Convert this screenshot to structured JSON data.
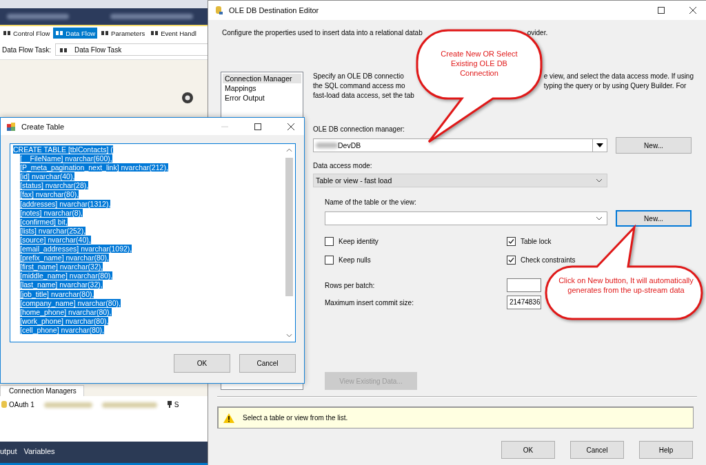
{
  "ide": {
    "designer_tabs": [
      {
        "label": "Control Flow",
        "selected": false
      },
      {
        "label": "Data Flow",
        "selected": true
      },
      {
        "label": "Parameters",
        "selected": false
      },
      {
        "label": "Event Handl",
        "selected": false
      }
    ],
    "task_label": "Data Flow Task:",
    "task_value": "Data Flow Task",
    "connection_managers": {
      "tab": "Connection Managers",
      "items": [
        "OAuth 1",
        "S"
      ]
    },
    "bottom_tabs": [
      "utput",
      "Variables"
    ]
  },
  "editor": {
    "title": "OLE DB Destination Editor",
    "description": [
      "Configure the properties used to insert data into a relational datab",
      "ovider."
    ],
    "pages": [
      {
        "label": "Connection Manager",
        "selected": true
      },
      {
        "label": "Mappings",
        "selected": false
      },
      {
        "label": "Error Output",
        "selected": false
      }
    ],
    "intro_left": [
      "Specify an OLE DB connectio",
      "the SQL command access mo",
      "fast-load data access, set the tab"
    ],
    "intro_right": [
      "e view, and select the data access mode. If using",
      "typing the query or by using Query Builder. For"
    ],
    "connection": {
      "label": "OLE DB connection manager:",
      "value": "DevDB",
      "button": {
        "label": "New...",
        "focused": false
      }
    },
    "access_mode": {
      "label": "Data access mode:",
      "value": "Table or view - fast load"
    },
    "table": {
      "label": "Name of the table or the view:",
      "button": {
        "label": "New...",
        "focused": true
      }
    },
    "options": [
      {
        "label": "Keep identity",
        "checked": false
      },
      {
        "label": "Table lock",
        "checked": true
      },
      {
        "label": "Keep nulls",
        "checked": false
      },
      {
        "label": "Check constraints",
        "checked": true
      }
    ],
    "rows_per_batch": {
      "label": "Rows per batch:"
    },
    "max_commit": {
      "label": "Maximum insert commit size:",
      "value": "21474836"
    },
    "view_button": {
      "label": "View Existing Data...",
      "disabled": true
    },
    "warning": "Select a table or view from the list.",
    "buttons": [
      "OK",
      "Cancel",
      "Help"
    ]
  },
  "create_table": {
    "title": "Create Table",
    "text_selected": true,
    "header": "CREATE TABLE [tblContacts] (",
    "columns": [
      "[__FileName] nvarchar(600),",
      "[P_meta_pagination_next_link] nvarchar(212),",
      "[id] nvarchar(40),",
      "[status] nvarchar(28),",
      "[fax] nvarchar(80),",
      "[addresses] nvarchar(1312),",
      "[notes] nvarchar(8),",
      "[confirmed] bit,",
      "[lists] nvarchar(252),",
      "[source] nvarchar(40),",
      "[email_addresses] nvarchar(1092),",
      "[prefix_name] nvarchar(80),",
      "[first_name] nvarchar(32),",
      "[middle_name] nvarchar(80),",
      "[last_name] nvarchar(32),",
      "[job_title] nvarchar(80),",
      "[company_name] nvarchar(80),",
      "[home_phone] nvarchar(80),",
      "[work_phone] nvarchar(80),",
      "[cell_phone] nvarchar(80),"
    ],
    "buttons": [
      "OK",
      "Cancel"
    ]
  },
  "callouts": [
    {
      "text": "Create New OR Select Existing OLE DB Connection"
    },
    {
      "text": "Click on New button, It will automatically generates from the up-stream data"
    }
  ]
}
